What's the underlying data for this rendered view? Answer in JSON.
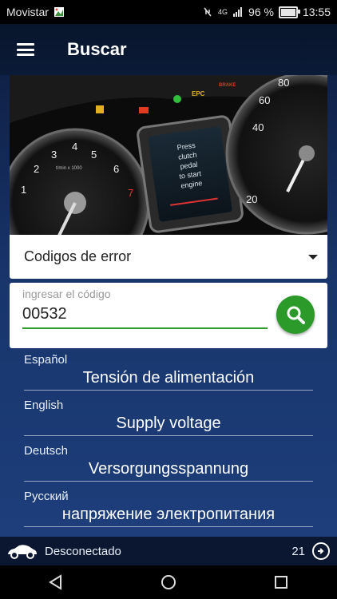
{
  "status_bar": {
    "carrier": "Movistar",
    "network": "4G",
    "battery_percent": "96 %",
    "time": "13:55"
  },
  "app_bar": {
    "title": "Buscar",
    "menu_icon": "hamburger-menu-icon"
  },
  "dashboard_image": {
    "cluster_text": [
      "Press",
      "clutch",
      "pedal",
      "to start",
      "engine"
    ],
    "gauge_unit": "t/min x 1000",
    "warning_labels": [
      "EPC",
      "BRAKE"
    ],
    "left_gauge_ticks": [
      "1",
      "2",
      "3",
      "4",
      "5",
      "6",
      "7"
    ],
    "right_gauge_ticks": [
      "20",
      "40",
      "60",
      "80"
    ]
  },
  "selector": {
    "label": "Codigos de error"
  },
  "search": {
    "placeholder": "ingresar el código",
    "value": "00532",
    "accent_color": "#2b9a2a"
  },
  "translations": [
    {
      "language": "Español",
      "text": "Tensión de alimentación"
    },
    {
      "language": "English",
      "text": "Supply voltage"
    },
    {
      "language": "Deutsch",
      "text": "Versorgungsspannung"
    },
    {
      "language": "Русский",
      "text": "напряжение электропитания"
    }
  ],
  "footer": {
    "connection_status": "Desconectado",
    "count": "21"
  }
}
